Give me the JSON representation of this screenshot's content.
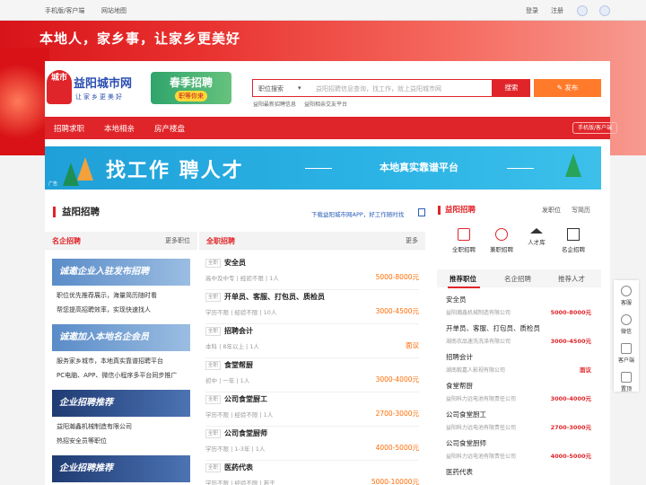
{
  "topbar": {
    "mobile": "手机版/客户端",
    "sitemap": "网站地图",
    "login": "登录",
    "register": "注册"
  },
  "hero": {
    "slogan": "本地人，家乡事，让家乡更美好"
  },
  "logo": {
    "badge": "城市",
    "name": "益阳城市网",
    "sub": "让家乡更美好"
  },
  "spring": {
    "title": "春季招聘",
    "sub": "职等你来"
  },
  "search": {
    "category": "职位搜索",
    "placeholder": "益阳招聘信息查询，找工作，就上益阳城市网",
    "button": "搜索",
    "post": "发布",
    "hot": [
      "益阳最新招聘信息",
      "益阳相亲交友平台"
    ]
  },
  "nav": {
    "items": [
      "招聘求职",
      "本地相亲",
      "房产楼盘"
    ],
    "mobile": "手机版/客户端"
  },
  "banner": {
    "title": "找工作  聘人才",
    "sub": "本地真实靠谱平台",
    "ad": "广告"
  },
  "section": {
    "title": "益阳招聘",
    "app_link": "下载益阳城市网APP，好工作随时找"
  },
  "famous": {
    "header": "名企招聘",
    "more": "更多职位",
    "promos": [
      "诚邀企业入驻发布招聘",
      "诚邀加入本地名企会员",
      "企业招聘推荐",
      "企业招聘推荐"
    ],
    "texts": [
      "职位优先推荐展示，海量简历随时看",
      "帮您提高招聘效率，实现快速找人",
      "服务家乡城市，本地真实靠谱招聘平台",
      "PC电脑、APP、微信小程序多平台同步推广",
      "益阳瀚鑫机械制造有限公司",
      "热招安全员等职位"
    ]
  },
  "fulltime": {
    "header": "全职招聘",
    "more": "更多",
    "tag": "全职",
    "jobs": [
      {
        "title": "安全员",
        "detail": "高中及中专 | 经验不限 | 1人",
        "salary": "5000-8000元"
      },
      {
        "title": "开单员、客服、打包员、质检员",
        "detail": "学历不限 | 经验不限 | 10人",
        "salary": "3000-4500元"
      },
      {
        "title": "招聘会计",
        "detail": "本科 | 8年以上 | 1人",
        "salary": "面议"
      },
      {
        "title": "食堂帮厨",
        "detail": "初中 | 一年 | 1人",
        "salary": "3000-4000元"
      },
      {
        "title": "公司食堂厨工",
        "detail": "学历不限 | 经验不限 | 1人",
        "salary": "2700-3000元"
      },
      {
        "title": "公司食堂厨师",
        "detail": "学历不限 | 1-3年 | 1人",
        "salary": "4000-5000元"
      },
      {
        "title": "医药代表",
        "detail": "学历不限 | 经验不限 | 若干",
        "salary": "5000-10000元"
      }
    ]
  },
  "right": {
    "title": "益阳招聘",
    "post_job": "发职位",
    "write_resume": "写简历",
    "quick": [
      "全职招聘",
      "兼职招聘",
      "人才库",
      "名企招聘"
    ],
    "tabs": [
      "推荐职位",
      "名企招聘",
      "推荐人才"
    ],
    "jobs": [
      {
        "title": "安全员",
        "company": "益阳瀚鑫机械制造有限公司",
        "salary": "5000-8000元"
      },
      {
        "title": "开单员、客服、打包员、质检员",
        "company": "湖南衣品速洗洗涤有限公司",
        "salary": "3000-4500元"
      },
      {
        "title": "招聘会计",
        "company": "湖南毅嘉人影视有限公司",
        "salary": "面议"
      },
      {
        "title": "食堂帮厨",
        "company": "益阳科力远电池有限责任公司",
        "salary": "3000-4000元"
      },
      {
        "title": "公司食堂厨工",
        "company": "益阳科力远电池有限责任公司",
        "salary": "2700-3000元"
      },
      {
        "title": "公司食堂厨师",
        "company": "益阳科力远电池有限责任公司",
        "salary": "4000-5000元"
      },
      {
        "title": "医药代表",
        "company": "",
        "salary": ""
      }
    ]
  },
  "float": [
    "客服",
    "微信",
    "客户端",
    "置顶"
  ]
}
